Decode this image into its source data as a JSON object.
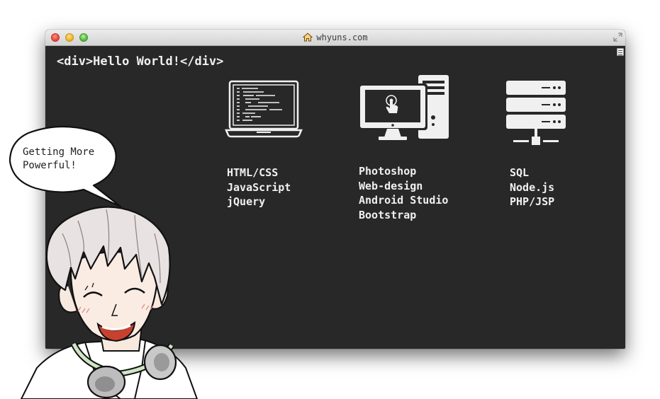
{
  "window": {
    "url": "whyuns.com"
  },
  "page": {
    "code_line": "<div>Hello World!</div>"
  },
  "skills": [
    {
      "icon": "laptop-code-icon",
      "items": [
        "HTML/CSS",
        "JavaScript",
        "jQuery"
      ]
    },
    {
      "icon": "desktop-computer-icon",
      "items": [
        "Photoshop",
        "Web-design",
        "Android Studio",
        "Bootstrap"
      ]
    },
    {
      "icon": "server-stack-icon",
      "items": [
        "SQL",
        "Node.js",
        "PHP/JSP"
      ]
    }
  ],
  "speech_bubble": {
    "lines": [
      "Getting More",
      "Powerful!"
    ]
  },
  "colors": {
    "terminal_bg": "#282828",
    "text": "#f0f0f0",
    "titlebar": "#dcdcdc",
    "close": "#e5443a",
    "minimize": "#e9b124",
    "zoom": "#54b23d"
  }
}
